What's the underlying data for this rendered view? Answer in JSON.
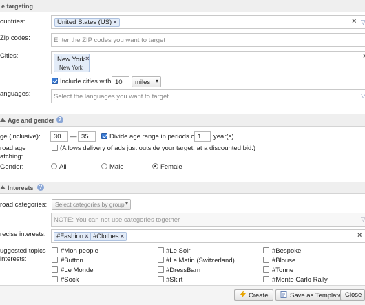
{
  "sections": {
    "location": {
      "title": "e targeting"
    },
    "age_gender": {
      "title": "Age and gender"
    },
    "interests": {
      "title": "Interests"
    }
  },
  "location": {
    "countries_label": "ountries:",
    "countries_tokens": [
      "United States (US)"
    ],
    "zip_label": "Zip codes:",
    "zip_placeholder": "Enter the ZIP codes you want to target",
    "cities_label": "Cities:",
    "city_token": {
      "name": "New York",
      "sub": "New York"
    },
    "include_cities_label": "Include cities within",
    "include_cities_checked": true,
    "radius_value": "10",
    "radius_unit": "miles",
    "languages_label": "anguages:",
    "languages_placeholder": "Select the languages you want to target"
  },
  "age_gender": {
    "age_label": "ge (inclusive):",
    "age_from": "30",
    "age_sep": "—",
    "age_to": "35",
    "divide_label": "Divide age range in periods of",
    "divide_checked": true,
    "period_value": "1",
    "period_unit": "year(s).",
    "broad_label_1": "road age",
    "broad_label_2": "atching:",
    "broad_text": "(Allows delivery of ads just outside your target, at a discounted bid.)",
    "broad_checked": false,
    "gender_label": "Gender:",
    "gender_options": [
      "All",
      "Male",
      "Female"
    ],
    "gender_selected": "Female"
  },
  "interests": {
    "broad_categories_label": "road categories:",
    "broad_categories_select": "Select categories by group",
    "note_placeholder": "NOTE: You can not use categories together",
    "precise_label": "recise interests:",
    "precise_tokens": [
      "#Fashion",
      "#Clothes"
    ],
    "suggested_label_1": "uggested topics",
    "suggested_label_2": "interests:",
    "suggested": [
      [
        "#Mon people",
        "#Le Soir",
        "#Bespoke"
      ],
      [
        "#Button",
        "#Le Matin (Switzerland)",
        "#Blouse"
      ],
      [
        "#Le Monde",
        "#DressBarn",
        "#Tonne"
      ],
      [
        "#Sock",
        "#Skirt",
        "#Monte Carlo Rally"
      ]
    ]
  },
  "footer": {
    "create_label": "Create",
    "save_template_label": "Save as Template",
    "close_label": "Close"
  },
  "colors": {
    "accent": "#3a7bd5",
    "token_bg": "#e3ecf8",
    "section_bg": "#efefef"
  }
}
